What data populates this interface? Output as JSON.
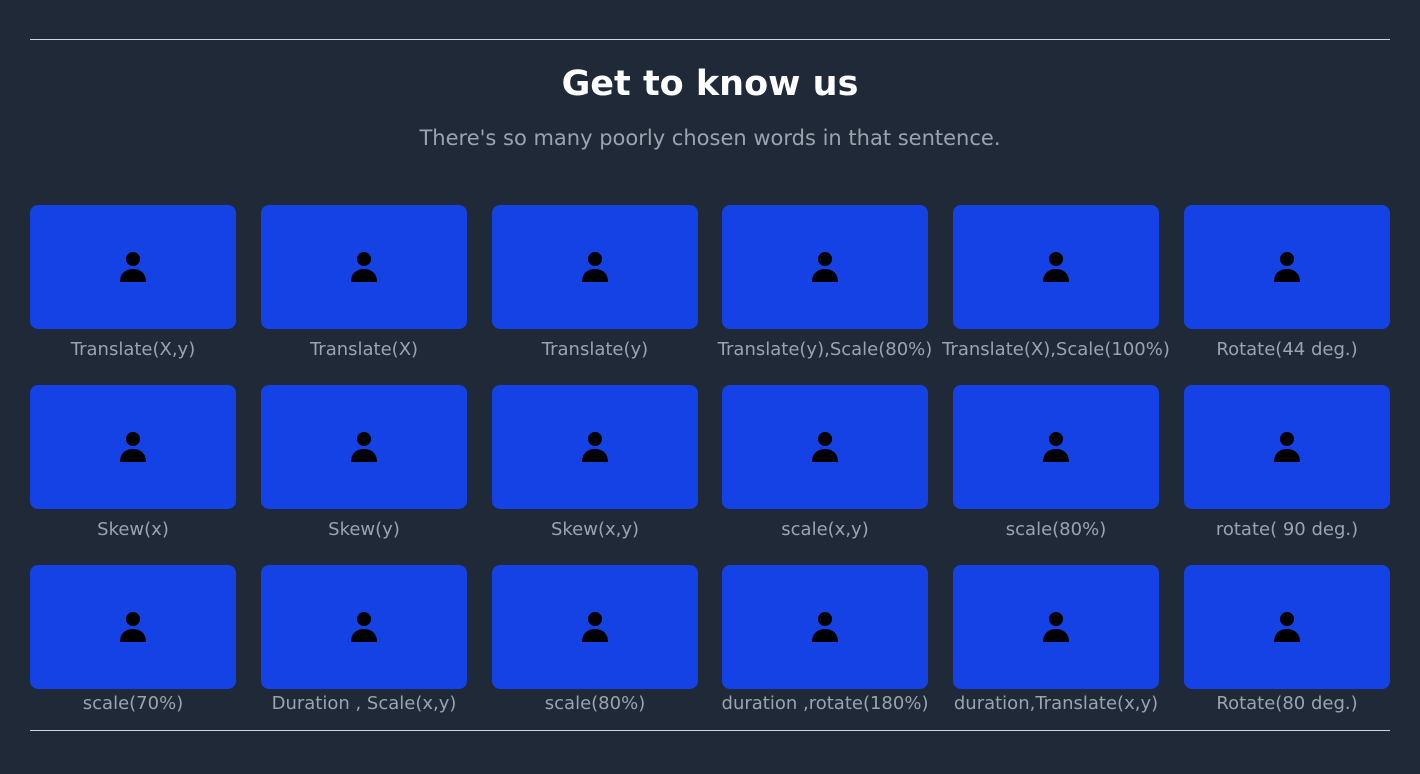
{
  "header": {
    "title": "Get to know us",
    "subtitle": "There's so many poorly chosen words in that sentence."
  },
  "colors": {
    "background": "#1f2937",
    "tile": "#1542e4",
    "title": "#ffffff",
    "text_muted": "#9ca3af",
    "divider": "#d1d5db"
  },
  "team": {
    "rows": [
      [
        {
          "caption": "Translate(X,y)",
          "icon": "person-icon"
        },
        {
          "caption": "Translate(X)",
          "icon": "person-icon"
        },
        {
          "caption": "Translate(y)",
          "icon": "person-icon"
        },
        {
          "caption": "Translate(y),Scale(80%)",
          "icon": "person-icon"
        },
        {
          "caption": "Translate(X),Scale(100%)",
          "icon": "person-icon"
        },
        {
          "caption": "Rotate(44 deg.)",
          "icon": "person-icon"
        }
      ],
      [
        {
          "caption": "Skew(x)",
          "icon": "person-icon"
        },
        {
          "caption": "Skew(y)",
          "icon": "person-icon"
        },
        {
          "caption": "Skew(x,y)",
          "icon": "person-icon"
        },
        {
          "caption": "scale(x,y)",
          "icon": "person-icon"
        },
        {
          "caption": "scale(80%)",
          "icon": "person-icon"
        },
        {
          "caption": "rotate( 90 deg.)",
          "icon": "person-icon"
        }
      ],
      [
        {
          "caption": "scale(70%)",
          "icon": "person-icon"
        },
        {
          "caption": "Duration , Scale(x,y)",
          "icon": "person-icon"
        },
        {
          "caption": "scale(80%)",
          "icon": "person-icon"
        },
        {
          "caption": "duration ,rotate(180%)",
          "icon": "person-icon"
        },
        {
          "caption": "duration,Translate(x,y)",
          "icon": "person-icon"
        },
        {
          "caption": "Rotate(80 deg.)",
          "icon": "person-icon"
        }
      ]
    ]
  }
}
